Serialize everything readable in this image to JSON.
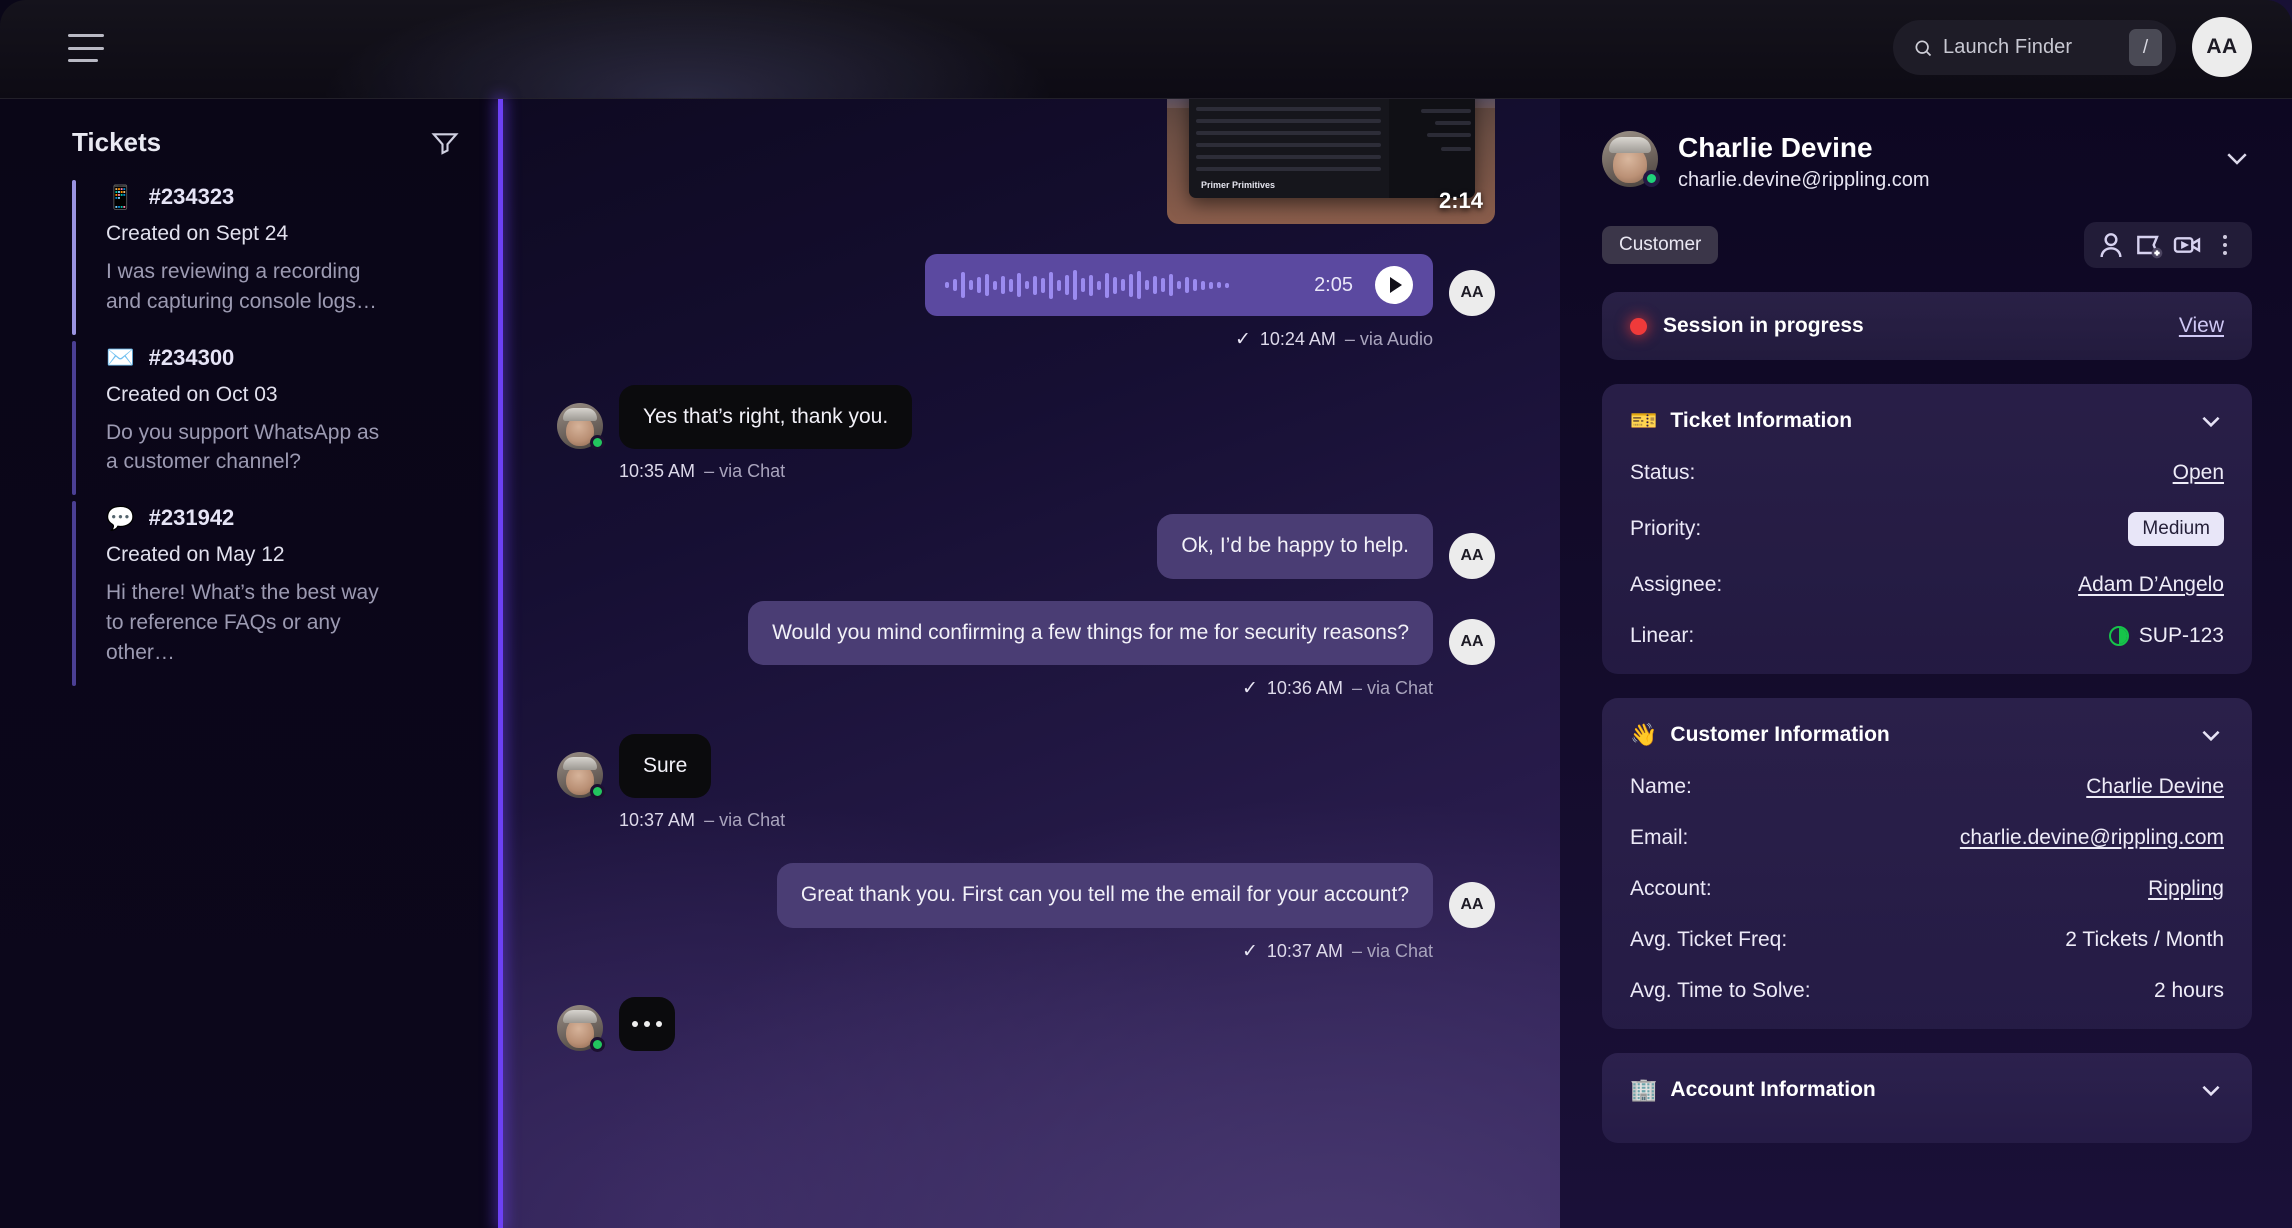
{
  "topbar": {
    "menu_icon": "hamburger-icon",
    "search": {
      "placeholder": "Launch Finder",
      "shortcut": "/",
      "icon": "search-icon"
    },
    "user_initials": "AA"
  },
  "sidebar": {
    "title": "Tickets",
    "filter_icon": "filter-icon",
    "tickets": [
      {
        "emoji": "📱",
        "id": "#234323",
        "created": "Created on Sept 24",
        "preview": "I was reviewing a recording and capturing console logs…"
      },
      {
        "emoji": "✉️",
        "id": "#234300",
        "created": "Created on Oct 03",
        "preview": "Do you support WhatsApp as a customer channel?"
      },
      {
        "emoji": "💬",
        "id": "#231942",
        "created": "Created on May 12",
        "preview": "Hi there! What’s the best way to reference FAQs or any other…"
      }
    ]
  },
  "chat": {
    "video": {
      "duration": "2:14",
      "caption": "Primer Primitives"
    },
    "audio": {
      "duration": "2:05",
      "agent_initials": "AA"
    },
    "messages": [
      {
        "side": "right",
        "kind": "audio",
        "meta_check": "✓",
        "meta_time": "10:24 AM",
        "meta_via": "– via Audio",
        "agent_initials": "AA"
      },
      {
        "side": "left",
        "kind": "text",
        "text": "Yes that’s right, thank you.",
        "meta_time": "10:35 AM",
        "meta_via": "– via Chat"
      },
      {
        "side": "right",
        "kind": "text",
        "text": "Ok, I’d be happy to help.",
        "agent_initials": "AA"
      },
      {
        "side": "right",
        "kind": "text",
        "text": "Would you mind confirming a few things for me for security reasons?",
        "meta_check": "✓",
        "meta_time": "10:36 AM",
        "meta_via": "– via Chat",
        "agent_initials": "AA"
      },
      {
        "side": "left",
        "kind": "text",
        "text": "Sure",
        "meta_time": "10:37 AM",
        "meta_via": "– via Chat"
      },
      {
        "side": "right",
        "kind": "text",
        "text": "Great thank you. First can you tell me the email for your account?",
        "meta_check": "✓",
        "meta_time": "10:37 AM",
        "meta_via": "– via Chat",
        "agent_initials": "AA"
      },
      {
        "side": "left",
        "kind": "typing"
      }
    ]
  },
  "right_panel": {
    "customer": {
      "name": "Charlie Devine",
      "email": "charlie.devine@rippling.com",
      "tag": "Customer",
      "collapse_icon": "chevron-down-icon",
      "actions": [
        "person-icon",
        "add-tag-icon",
        "video-icon",
        "more-options-icon"
      ]
    },
    "session": {
      "label": "Session in progress",
      "action_label": "View",
      "status_color": "#ef3a3a"
    },
    "ticket_information": {
      "emoji": "🎫",
      "title": "Ticket Information",
      "rows": [
        {
          "label": "Status:",
          "value": "Open",
          "style": "link"
        },
        {
          "label": "Priority:",
          "value": "Medium",
          "style": "pill"
        },
        {
          "label": "Assignee:",
          "value": "Adam D’Angelo",
          "style": "link"
        },
        {
          "label": "Linear:",
          "value": "SUP-123",
          "style": "linear"
        }
      ]
    },
    "customer_information": {
      "emoji": "👋",
      "title": "Customer Information",
      "rows": [
        {
          "label": "Name:",
          "value": "Charlie Devine",
          "style": "link"
        },
        {
          "label": "Email:",
          "value": "charlie.devine@rippling.com",
          "style": "link"
        },
        {
          "label": "Account:",
          "value": "Rippling",
          "style": "link"
        },
        {
          "label": "Avg. Ticket Freq:",
          "value": "2 Tickets / Month",
          "style": "plain"
        },
        {
          "label": "Avg. Time to Solve:",
          "value": "2 hours",
          "style": "plain"
        }
      ]
    },
    "account_information": {
      "emoji": "🏢",
      "title": "Account Information"
    }
  }
}
